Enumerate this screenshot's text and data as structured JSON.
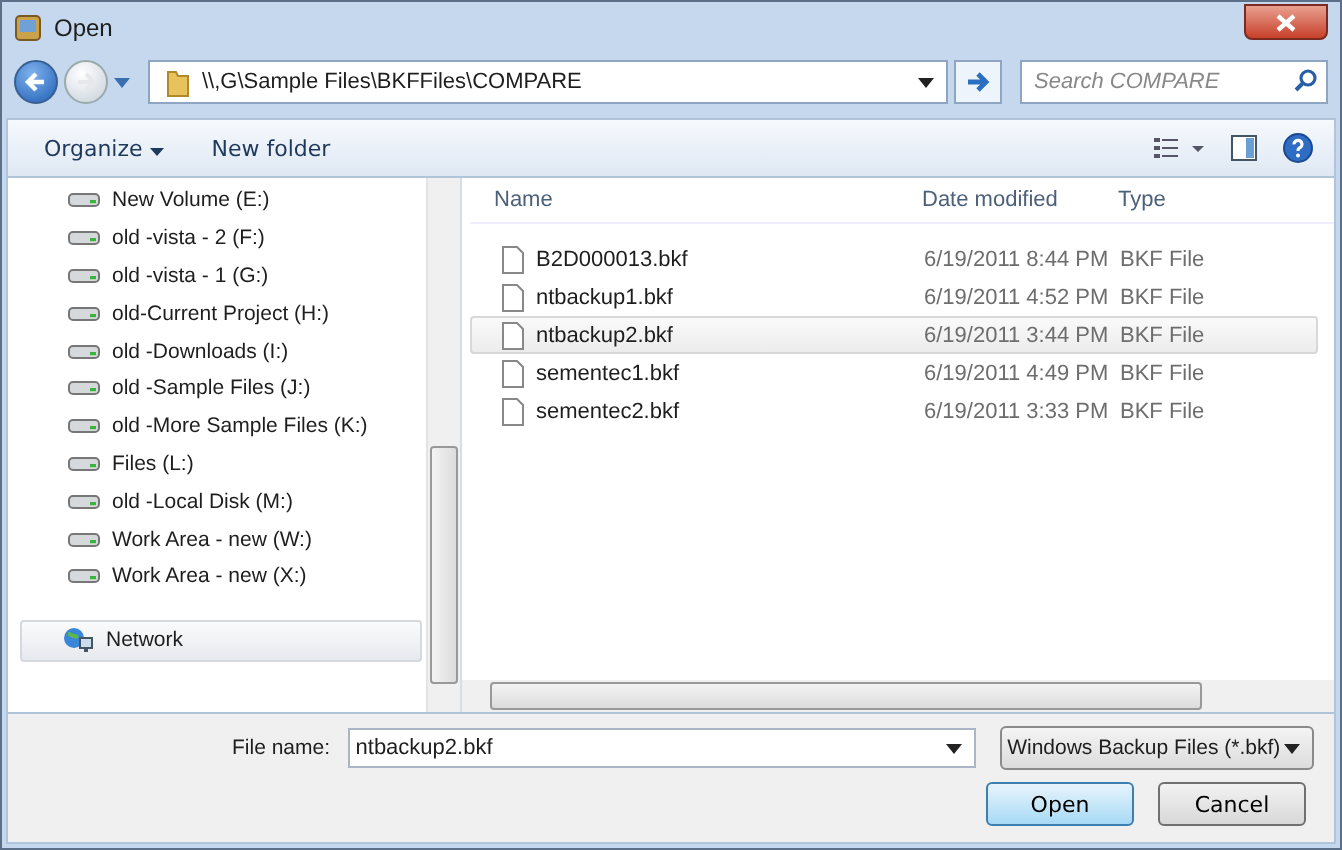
{
  "window": {
    "title": "Open"
  },
  "address": {
    "path": "\\\\,G\\Sample Files\\BKFFiles\\COMPARE"
  },
  "search": {
    "placeholder": "Search COMPARE"
  },
  "toolbar": {
    "organize": "Organize",
    "new_folder": "New folder"
  },
  "sidebar": {
    "items": [
      {
        "label": "New Volume (E:)",
        "kind": "drive",
        "selected": false
      },
      {
        "label": "old -vista - 2  (F:)",
        "kind": "drive",
        "selected": false
      },
      {
        "label": "old -vista - 1 (G:)",
        "kind": "drive",
        "selected": false
      },
      {
        "label": "old-Current Project (H:)",
        "kind": "drive",
        "selected": false
      },
      {
        "label": "old -Downloads (I:)",
        "kind": "drive",
        "selected": false
      },
      {
        "label": "old -Sample Files (J:)",
        "kind": "drive",
        "selected": false
      },
      {
        "label": "old -More Sample Files (K:)",
        "kind": "drive",
        "selected": false
      },
      {
        "label": "Files (L:)",
        "kind": "drive",
        "selected": false
      },
      {
        "label": "old -Local Disk (M:)",
        "kind": "drive",
        "selected": false
      },
      {
        "label": "Work Area - new (W:)",
        "kind": "drive",
        "selected": false
      },
      {
        "label": "Work Area - new (X:)",
        "kind": "drive",
        "selected": false
      },
      {
        "label": "Network",
        "kind": "network",
        "selected": true
      }
    ]
  },
  "table": {
    "columns": [
      "Name",
      "Date modified",
      "Type"
    ],
    "rows": [
      {
        "name": "B2D000013.bkf",
        "date": "6/19/2011 8:44 PM",
        "type": "BKF File",
        "selected": false
      },
      {
        "name": "ntbackup1.bkf",
        "date": "6/19/2011 4:52 PM",
        "type": "BKF File",
        "selected": false
      },
      {
        "name": "ntbackup2.bkf",
        "date": "6/19/2011 3:44 PM",
        "type": "BKF File",
        "selected": true
      },
      {
        "name": "sementec1.bkf",
        "date": "6/19/2011 4:49 PM",
        "type": "BKF File",
        "selected": false
      },
      {
        "name": "sementec2.bkf",
        "date": "6/19/2011 3:33 PM",
        "type": "BKF File",
        "selected": false
      }
    ]
  },
  "file_name": {
    "label": "File name:",
    "value": "ntbackup2.bkf"
  },
  "file_type": {
    "value": "Windows Backup Files (*.bkf)"
  },
  "buttons": [
    "Open",
    "Cancel"
  ]
}
